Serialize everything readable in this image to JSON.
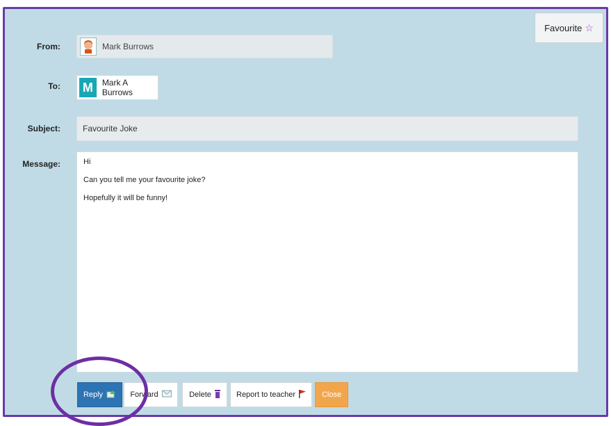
{
  "toolbar": {
    "favourite_label": "Favourite",
    "favourite_icon": "star-outline-icon"
  },
  "labels": {
    "from": "From:",
    "to": "To:",
    "subject": "Subject:",
    "message": "Message:"
  },
  "from": {
    "name": "Mark Burrows",
    "avatar": "avatar-icon"
  },
  "to": {
    "initial": "M",
    "name": "Mark A Burrows"
  },
  "subject": "Favourite Joke",
  "message": {
    "lines": [
      "Hi",
      "Can you tell me your favourite joke?",
      "Hopefully it will be funny!"
    ]
  },
  "actions": {
    "reply": "Reply",
    "forward": "Forward",
    "delete": "Delete",
    "report": "Report to teacher",
    "close": "Close"
  },
  "colors": {
    "panel": "#c0dbe6",
    "border": "#6a3aa8",
    "reply_button": "#2c74b4",
    "close_button": "#f2a64b",
    "to_badge": "#18a7b5",
    "highlight_circle": "#6d2fa3"
  }
}
